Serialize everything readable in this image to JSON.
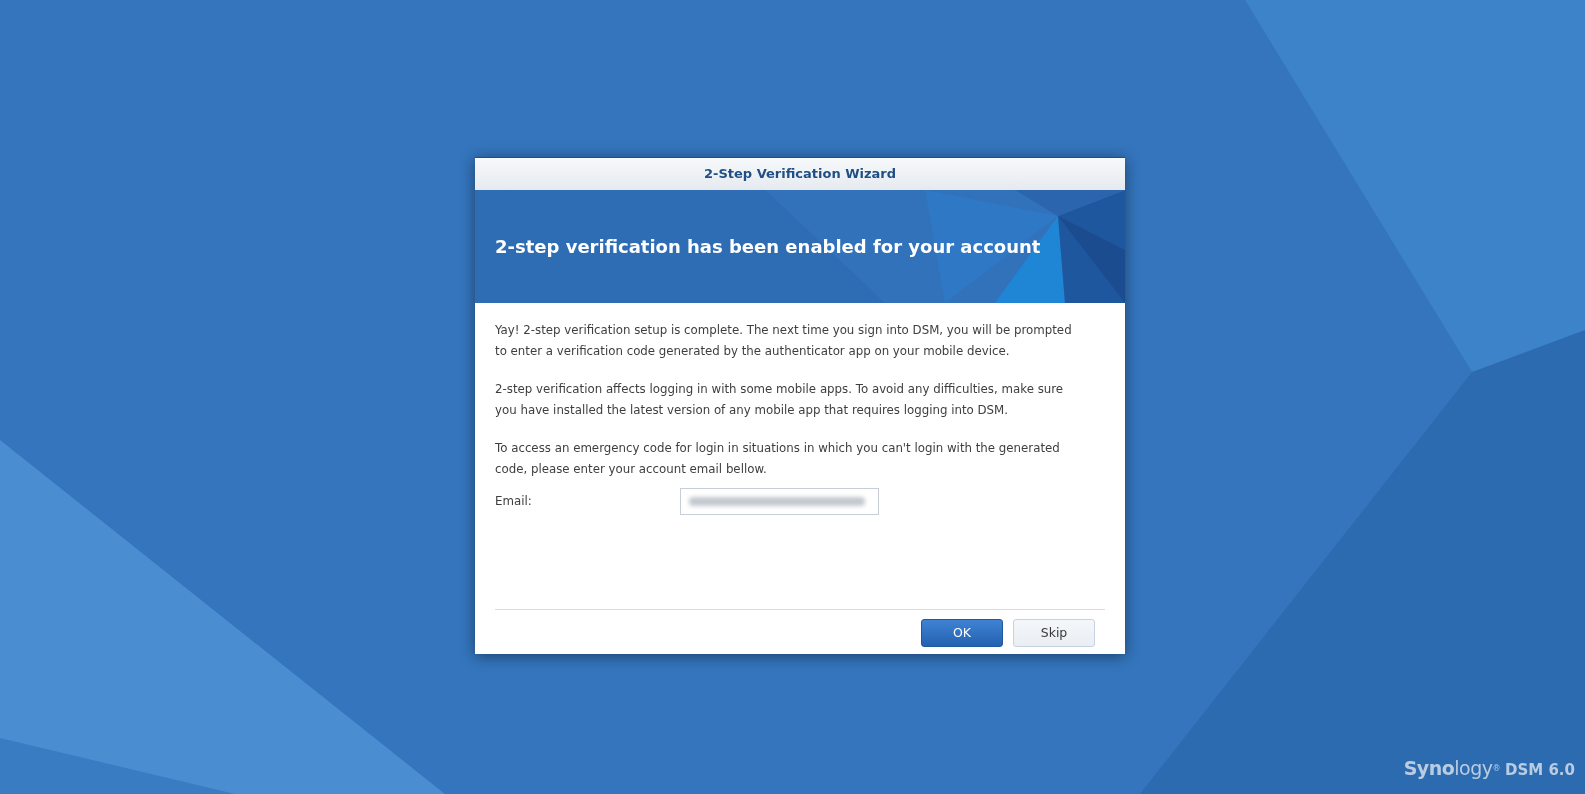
{
  "dialog": {
    "title": "2-Step Verification Wizard",
    "heading": "2-step verification has been enabled for your account",
    "paragraphs": [
      {
        "lines": [
          "Yay! 2-step verification setup is complete. The next time you sign into DSM, you will be prompted",
          "to enter a verification code generated by the authenticator app on your mobile device."
        ]
      },
      {
        "lines": [
          "2-step verification affects logging in with some mobile apps. To avoid any difficulties, make sure",
          "you have installed the latest version of any mobile app that requires logging into DSM."
        ]
      },
      {
        "lines": [
          "To access an emergency code for login in situations in which you can't login with the generated",
          "code, please enter your account email bellow."
        ]
      }
    ],
    "email_field": {
      "label": "Email:"
    },
    "buttons": [
      {
        "label": "OK",
        "kind": "primary"
      },
      {
        "label": "Skip",
        "kind": "secondary"
      }
    ]
  },
  "branding": {
    "logo": "**Syno**logy$^{®}$",
    "product": "DSM 6.0"
  }
}
